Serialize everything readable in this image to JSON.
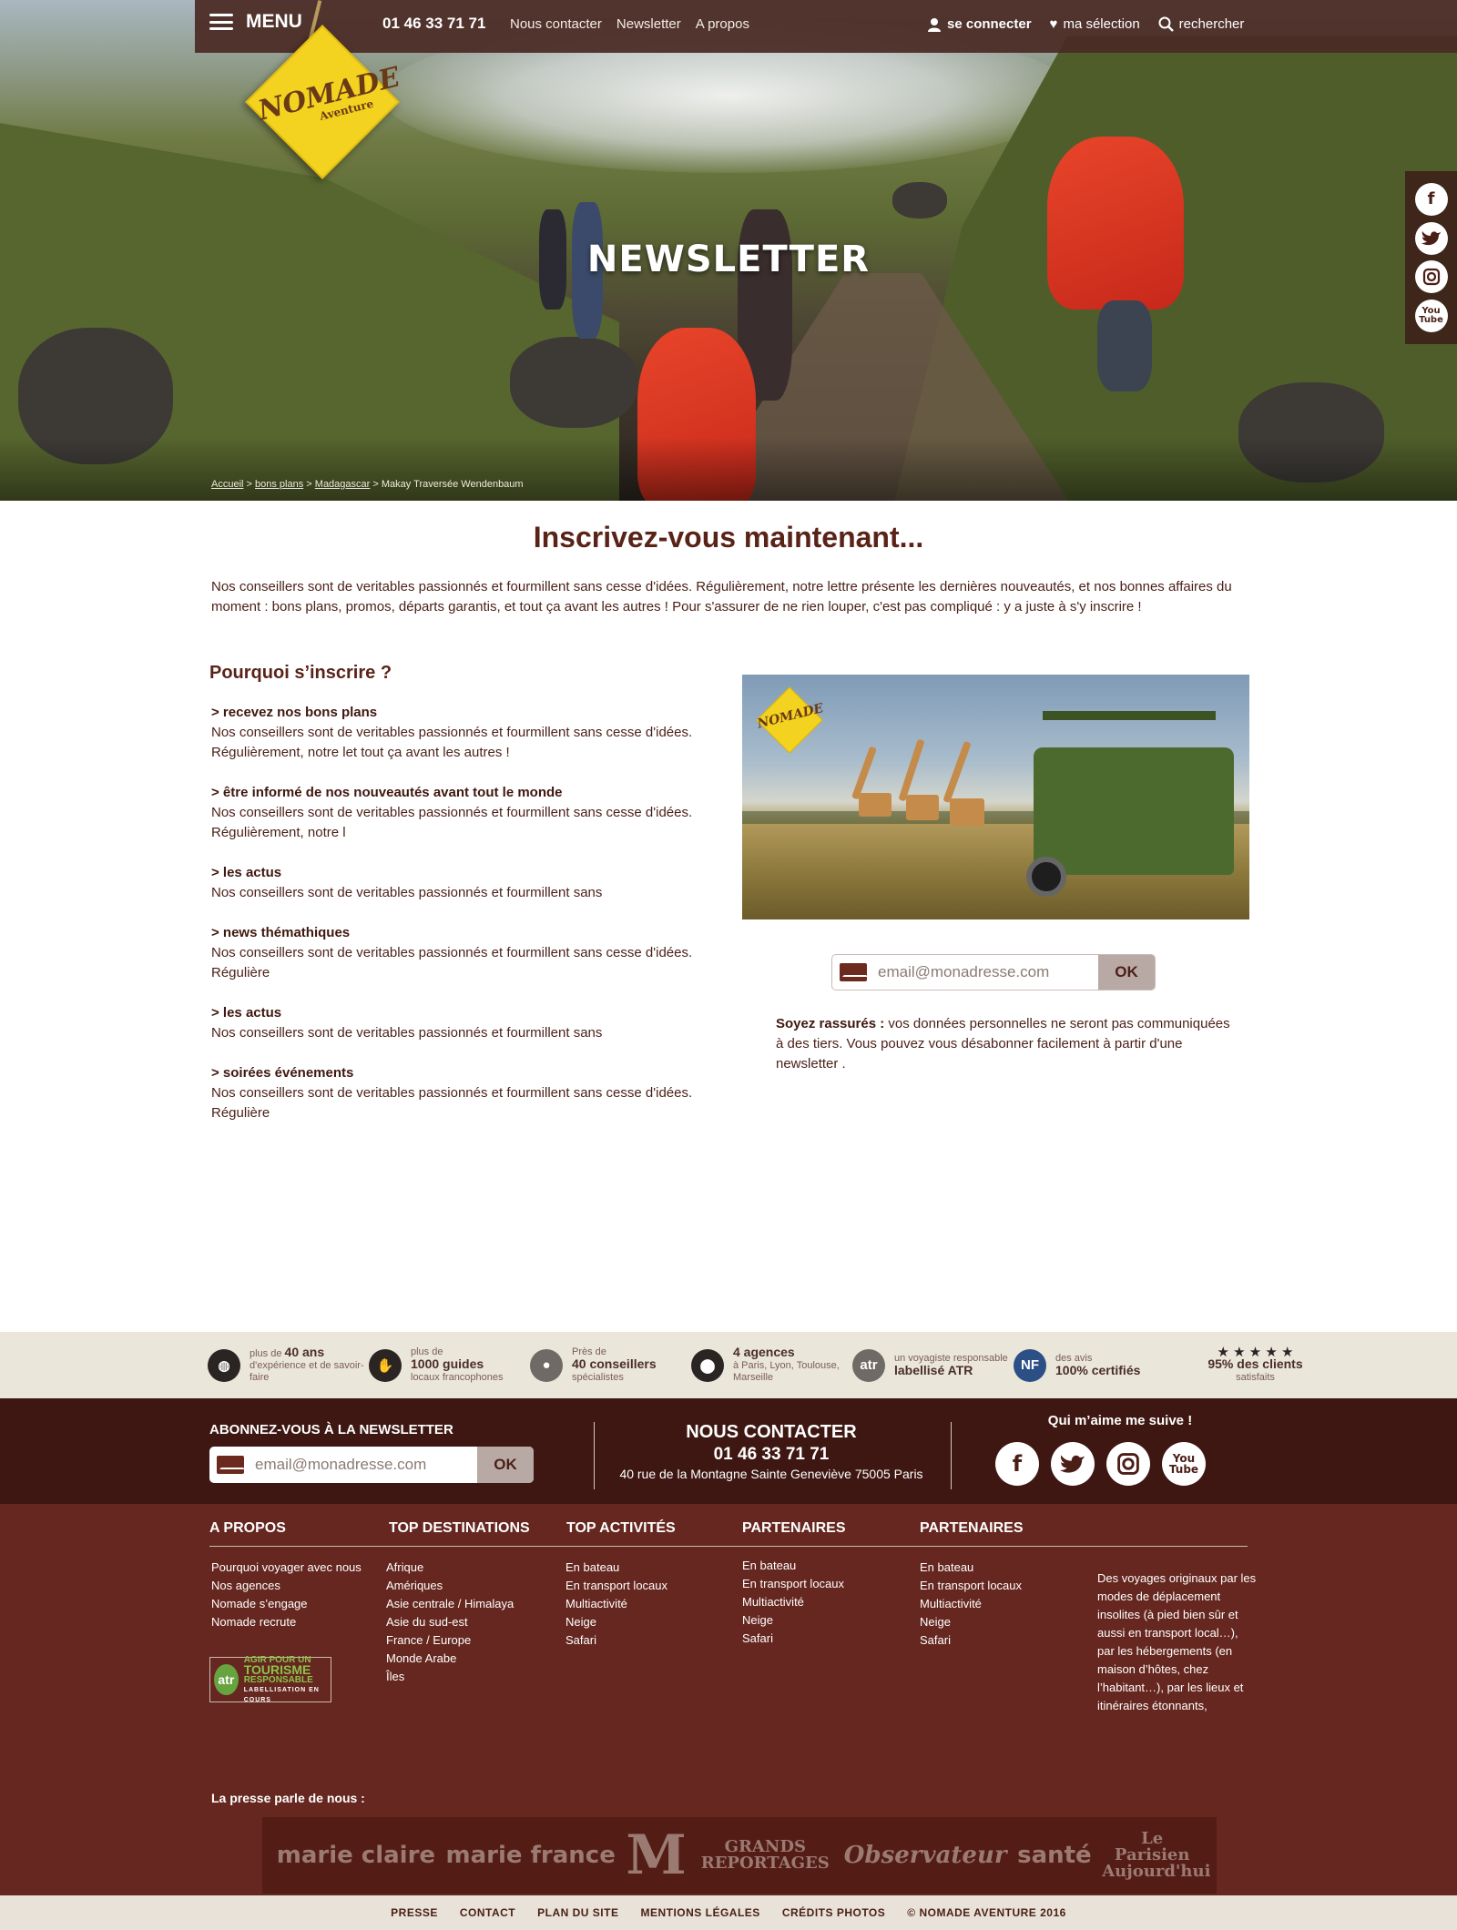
{
  "header": {
    "menu_label": "MENU",
    "phone": "01 46 33 71 71",
    "links": [
      "Nous contacter",
      "Newsletter",
      "A propos"
    ],
    "login": "se connecter",
    "selection": "ma sélection",
    "search": "rechercher"
  },
  "logo": {
    "main": "NOMADE",
    "sub": "Aventure"
  },
  "hero": {
    "title": "NEWSLETTER",
    "breadcrumb": [
      "Accueil",
      "bons plans",
      "Madagascar",
      "Makay Traversée Wendenbaum"
    ]
  },
  "social": {
    "facebook": "f",
    "twitter": "t",
    "instagram": "◘",
    "youtube_top": "You",
    "youtube_bottom": "Tube"
  },
  "main": {
    "title": "Inscrivez-vous maintenant...",
    "intro": "Nos conseillers sont de veritables passionnés et fourmillent sans cesse d'idées. Régulièrement, notre lettre présente les dernières nouveautés, et nos bonnes affaires du moment : bons plans, promos, départs garantis, et tout ça avant les autres ! Pour s'assurer de ne rien louper, c'est pas compliqué : y a juste à s'y inscrire !",
    "why_title": "Pourquoi s’inscrire ?",
    "why_items": [
      {
        "title": "> recevez nos bons plans",
        "text": "Nos conseillers sont de veritables passionnés et fourmillent sans cesse d'idées. Régulièrement, notre let tout ça avant les autres !"
      },
      {
        "title": "> être informé de nos nouveautés avant tout le monde",
        "text": "Nos conseillers sont de veritables passionnés et fourmillent sans cesse d'idées. Régulièrement, notre l"
      },
      {
        "title": "> les actus",
        "text": "Nos conseillers sont de veritables passionnés et fourmillent sans"
      },
      {
        "title": "> news thémathiques",
        "text": "Nos conseillers sont de veritables passionnés et fourmillent sans cesse d'idées. Régulière"
      },
      {
        "title": "> les actus",
        "text": "Nos conseillers sont de veritables passionnés et fourmillent sans"
      },
      {
        "title": "> soirées événements",
        "text": "Nos conseillers sont de veritables passionnés et fourmillent sans cesse d'idées. Régulière"
      }
    ],
    "email_placeholder": "email@monadresse.com",
    "ok_label": "OK",
    "rassure_bold": "Soyez rassurés :",
    "rassure_text": " vos données personnelles ne seront pas communiquées à des tiers. Vous pouvez vous désabonner facilement à partir d'une newsletter ."
  },
  "badges": [
    {
      "icon": "globe-icon",
      "pre": "plus de ",
      "strong": "40 ans",
      "post": "d'expérience et de savoir-faire"
    },
    {
      "icon": "handshake-icon",
      "pre": "plus de",
      "strong": "1000 guides",
      "post": "locaux francophones"
    },
    {
      "icon": "people-icon",
      "pre": "Près de",
      "strong": "40 conseillers",
      "post": "spécialistes"
    },
    {
      "icon": "pin-icon",
      "pre": "",
      "strong": "4 agences",
      "post": "à Paris, Lyon, Toulouse, Marseille"
    },
    {
      "icon": "atr-icon",
      "pre": "un voyagiste responsable",
      "strong": "labellisé ATR",
      "post": ""
    },
    {
      "icon": "nf-icon",
      "pre": "des avis",
      "strong": "100% certifiés",
      "post": ""
    },
    {
      "icon": "stars-icon",
      "pre": "★ ★ ★ ★ ★",
      "strong": "95% des clients",
      "post": "satisfaits"
    }
  ],
  "footer": {
    "newsletter_title": "ABONNEZ-VOUS À LA NEWSLETTER",
    "email_placeholder": "email@monadresse.com",
    "ok_label": "OK",
    "contact_title": "NOUS CONTACTER",
    "contact_phone": "01 46 33 71 71",
    "contact_address": "40 rue de la Montagne Sainte Geneviève 75005 Paris",
    "follow_title": "Qui m’aime me suive !",
    "columns": [
      {
        "title": "A PROPOS",
        "items": [
          "Pourquoi voyager avec nous",
          "Nos agences",
          "Nomade s’engage",
          "Nomade recrute"
        ]
      },
      {
        "title": "TOP DESTINATIONS",
        "items": [
          "Afrique",
          "Amériques",
          "Asie centrale / Himalaya",
          "Asie du sud-est",
          "France / Europe",
          " Monde Arabe",
          "Îles"
        ]
      },
      {
        "title": "TOP ACTIVITÉS",
        "items": [
          "En bateau",
          "En transport locaux",
          "Multiactivité",
          "Neige",
          "Safari"
        ]
      },
      {
        "title": "PARTENAIRES",
        "items": [
          "En bateau",
          "En transport locaux",
          "Multiactivité",
          "Neige",
          "Safari"
        ]
      },
      {
        "title": "PARTENAIRES",
        "items": [
          "En bateau",
          "En transport locaux",
          "Multiactivité",
          "Neige",
          "Safari"
        ]
      }
    ],
    "description": "Des voyages originaux par les modes de déplacement insolites (à pied bien sûr et aussi en transport local…), par les hébergements (en maison d’hôtes, chez l’habitant…), par les lieux et itinéraires étonnants,",
    "atr": {
      "circle": "atr",
      "line1": "AGIR POUR UN",
      "line2": "TOURISME",
      "line3": "RESPONSABLE",
      "line4": "LABELLISATION EN COURS"
    },
    "presse_title": "La presse parle de nous :",
    "presse": [
      "marie claire",
      "marie france",
      "M",
      "GRANDS REPORTAGES",
      "Observateur",
      "santé",
      "Le Parisien Aujourd'hui"
    ],
    "bottom_links": [
      "PRESSE",
      "CONTACT",
      "PLAN DU SITE",
      "MENTIONS LÉGALES",
      "CRÉDITS PHOTOS",
      "© NOMADE AVENTURE 2016"
    ]
  }
}
